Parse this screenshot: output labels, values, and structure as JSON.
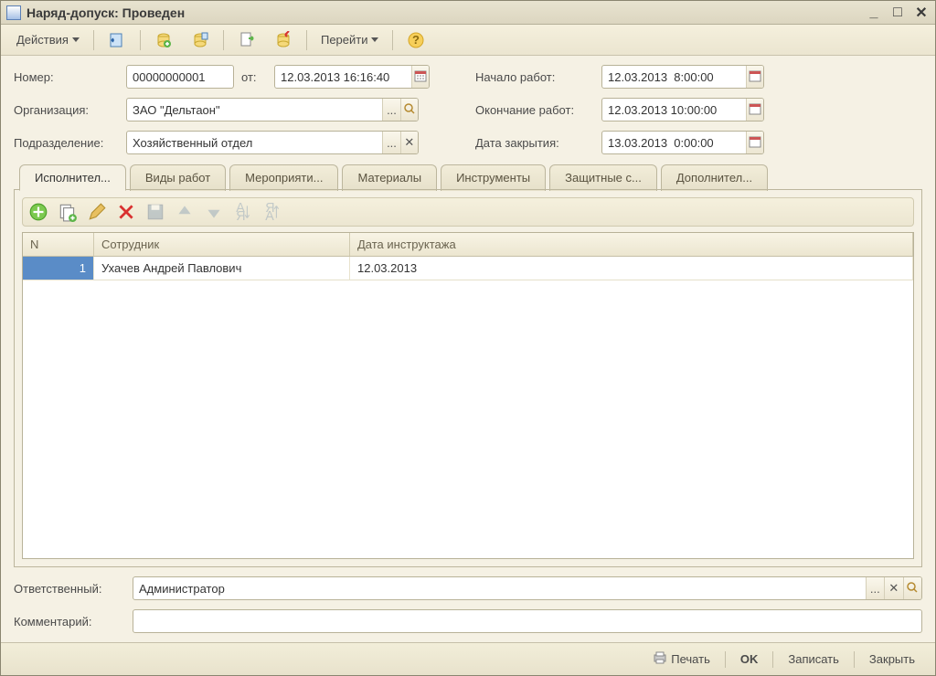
{
  "title": "Наряд-допуск: Проведен",
  "toolbar": {
    "actions": "Действия",
    "goto": "Перейти"
  },
  "form": {
    "number_label": "Номер:",
    "number_value": "00000000001",
    "from_label": "от:",
    "from_value": "12.03.2013 16:16:40",
    "org_label": "Организация:",
    "org_value": "ЗАО \"Дельтаон\"",
    "dept_label": "Подразделение:",
    "dept_value": "Хозяйственный отдел",
    "start_label": "Начало работ:",
    "start_value": "12.03.2013  8:00:00",
    "end_label": "Окончание работ:",
    "end_value": "12.03.2013 10:00:00",
    "close_label": "Дата закрытия:",
    "close_value": "13.03.2013  0:00:00",
    "resp_label": "Ответственный:",
    "resp_value": "Администратор",
    "comment_label": "Комментарий:"
  },
  "tabs": {
    "t1": "Исполнител...",
    "t2": "Виды работ",
    "t3": "Мероприяти...",
    "t4": "Материалы",
    "t5": "Инструменты",
    "t6": "Защитные с...",
    "t7": "Дополнител..."
  },
  "table": {
    "col_n": "N",
    "col_emp": "Сотрудник",
    "col_date": "Дата инструктажа",
    "rows": [
      {
        "n": "1",
        "emp": "Ухачев Андрей Павлович",
        "date": "12.03.2013"
      }
    ]
  },
  "footer": {
    "print": "Печать",
    "ok": "OK",
    "save": "Записать",
    "close": "Закрыть"
  }
}
